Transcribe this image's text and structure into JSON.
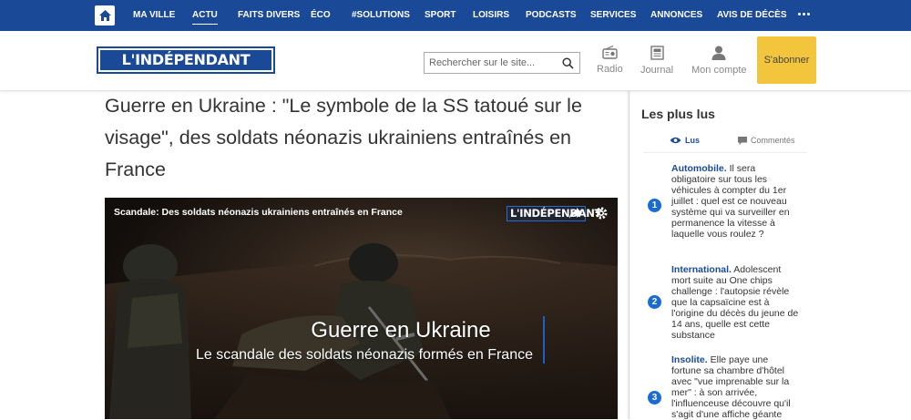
{
  "nav": {
    "items": [
      {
        "label": "MA VILLE"
      },
      {
        "label": "ACTU"
      },
      {
        "label": "FAITS DIVERS"
      },
      {
        "label": "ÉCO"
      },
      {
        "label": "#SOLUTIONS"
      },
      {
        "label": "SPORT"
      },
      {
        "label": "LOISIRS"
      },
      {
        "label": "PODCASTS"
      },
      {
        "label": "SERVICES"
      },
      {
        "label": "ANNONCES"
      },
      {
        "label": "AVIS DE DÉCÈS"
      }
    ],
    "active": "ACTU",
    "colors": {
      "bar": "#1a4a97"
    }
  },
  "header": {
    "logo_text": "L'INDÉPENDANT",
    "search_placeholder": "Rechercher sur le site...",
    "tools": {
      "radio": "Radio",
      "journal": "Journal",
      "account": "Mon compte"
    },
    "subscribe": "S'abonner",
    "subscribe_color": "#f2c53d"
  },
  "article": {
    "headline": "Guerre en Ukraine : \"Le symbole de la SS tatoué sur le visage\", des soldats néonazis ukrainiens entraînés en France",
    "video": {
      "top_title": "Scandale: Des soldats néonazis ukrainiens entraînés en France",
      "logo_text": "L'INDÉPENDANT",
      "overlay_title": "Guerre en Ukraine",
      "overlay_subtitle": "Le scandale des soldats néonazis formés en France"
    }
  },
  "sidebar": {
    "title": "Les plus lus",
    "tabs": {
      "read": "Lus",
      "commented": "Commentés"
    },
    "articles": [
      {
        "num": "1",
        "category": "Automobile.",
        "text": "Il sera obligatoire sur tous les véhicules à compter du 1er juillet : quel est ce nouveau système qui va surveiller en permanence la vitesse à laquelle vous roulez ?"
      },
      {
        "num": "2",
        "category": "International.",
        "text": "Adolescent mort suite au One chips challenge : l'autopsie révèle que la capsaïcine est à l'origine du décès du jeune de 14 ans, quelle est cette substance"
      },
      {
        "num": "3",
        "category": "Insolite.",
        "text": "Elle paye une fortune sa chambre d'hôtel avec \"vue imprenable sur la mer\" : à son arrivée, l'influenceuse découvre qu'il s'agit d'une affiche géante"
      }
    ]
  }
}
